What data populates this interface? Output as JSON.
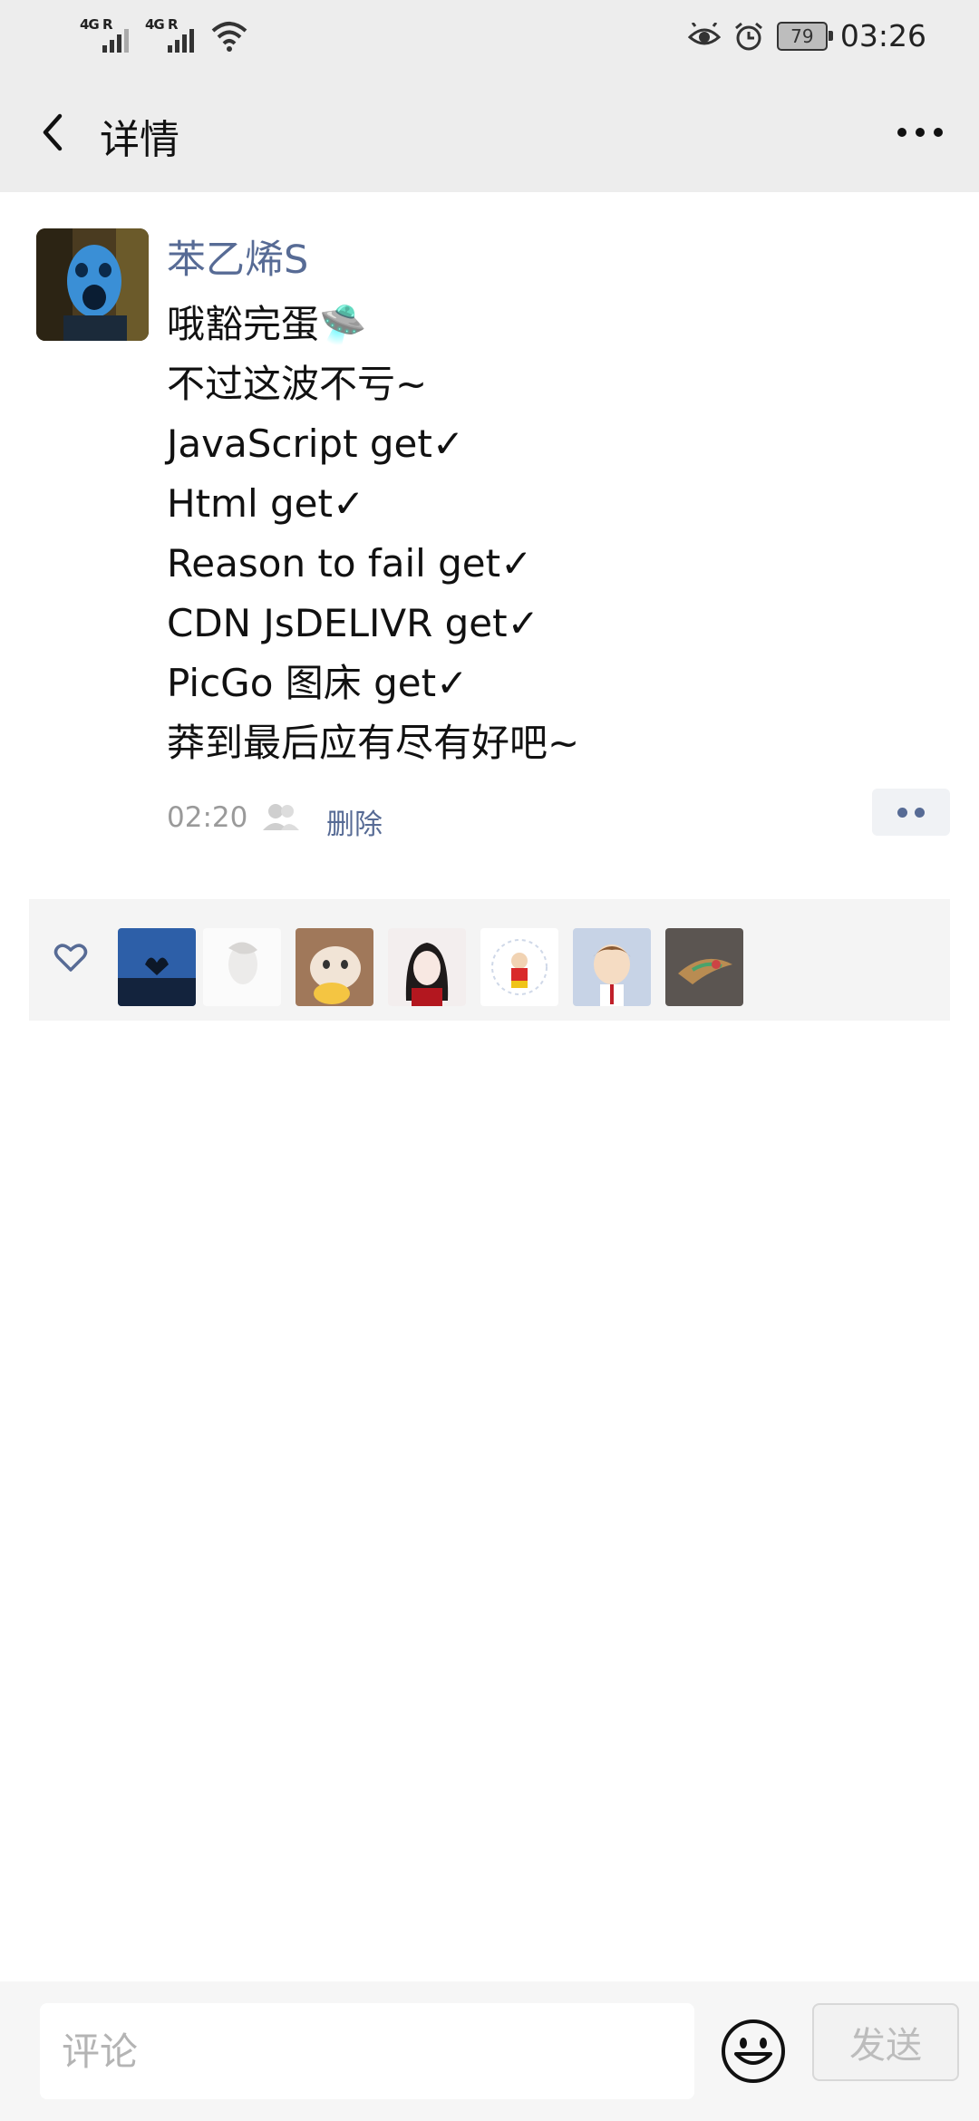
{
  "status_bar": {
    "signal1_label": "4G R",
    "signal2_label": "4G R",
    "battery": "79",
    "time": "03:26",
    "icons": [
      "signal-icon",
      "signal-icon",
      "wifi-icon",
      "eye-icon",
      "alarm-icon",
      "battery-icon"
    ]
  },
  "nav": {
    "title": "详情",
    "back_icon": "chevron-left-icon",
    "more_icon": "more-dots-icon"
  },
  "post": {
    "author": "苯乙烯S",
    "lines": [
      "哦豁完蛋🛸",
      "不过这波不亏~",
      "JavaScript get✓",
      "Html get✓",
      "Reason to fail get✓",
      "CDN JsDELIVR get✓",
      "PicGo 图床 get✓",
      "莽到最后应有尽有好吧~"
    ],
    "time": "02:20",
    "delete_label": "删除"
  },
  "likes": {
    "icon": "heart-icon",
    "count": 7
  },
  "comment_bar": {
    "placeholder": "评论",
    "send_label": "发送",
    "emoji_icon": "smiley-icon"
  },
  "colors": {
    "link": "#576b95",
    "bar_bg": "#ededed",
    "likes_bg": "#f4f4f4"
  }
}
